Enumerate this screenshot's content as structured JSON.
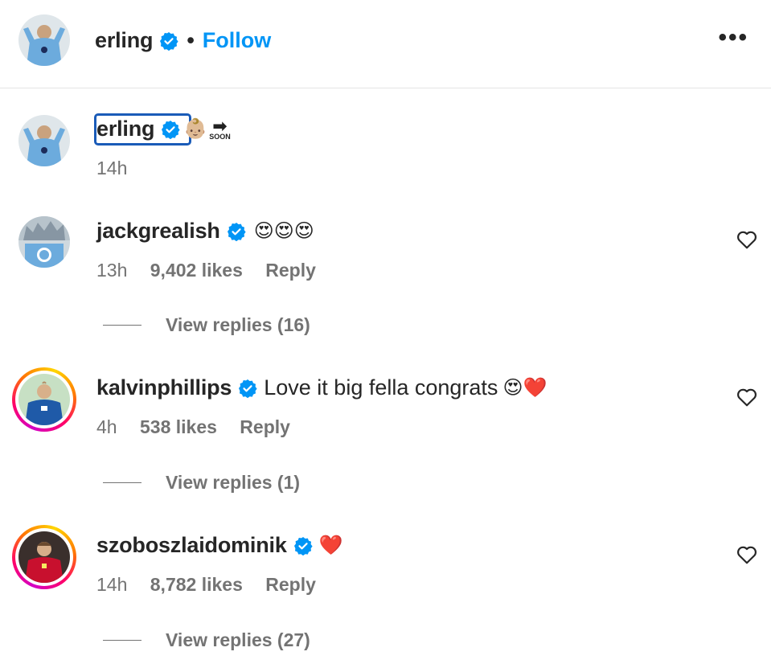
{
  "header": {
    "username": "erling",
    "separator": "•",
    "follow_label": "Follow",
    "more_label": "•••"
  },
  "caption": {
    "username": "erling",
    "emoji": "👶🏼",
    "soon_arrow": "➡",
    "soon_text": "SOON",
    "time": "14h"
  },
  "comments": [
    {
      "username": "jackgrealish",
      "text": "",
      "emoji": "😍😍😍",
      "time": "13h",
      "likes": "9,402 likes",
      "reply_label": "Reply",
      "view_replies": "View replies (16)"
    },
    {
      "username": "kalvinphillips",
      "text": "Love it big fella congrats",
      "emoji": "😍❤️",
      "time": "4h",
      "likes": "538 likes",
      "reply_label": "Reply",
      "view_replies": "View replies (1)"
    },
    {
      "username": "szoboszlaidominik",
      "text": "",
      "emoji": "❤️",
      "time": "14h",
      "likes": "8,782 likes",
      "reply_label": "Reply",
      "view_replies": "View replies (27)"
    }
  ],
  "colors": {
    "follow": "#0095f6",
    "verified": "#0095f6",
    "muted": "#737373",
    "story_ring": "#ff0069"
  },
  "icons": {
    "verified": "verified-badge-icon",
    "like": "heart-outline-icon",
    "more": "more-options-icon"
  }
}
